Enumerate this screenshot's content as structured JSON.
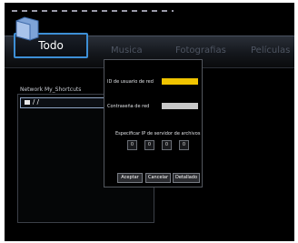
{
  "tabs": {
    "active_label": "Todo",
    "items": [
      "Musica",
      "Fotografias",
      "Películas"
    ]
  },
  "breadcrumb": "Network  My_Shortcuts",
  "list": {
    "selected_item": "/ /"
  },
  "dialog": {
    "username_label": "ID de usuario de red",
    "username_value": "",
    "password_label": "Contraseña de red",
    "password_value": "",
    "server_ip_label": "Especificar IP de servidor de archivos",
    "ip_octets": [
      "0",
      "0",
      "0",
      "0"
    ],
    "buttons": {
      "accept": "Aceptar",
      "cancel": "Cancelar",
      "detail": "Detallado"
    }
  },
  "colors": {
    "accent": "#3d8fd6",
    "username_field": "#f0c400",
    "password_field": "#c8c8c8"
  }
}
